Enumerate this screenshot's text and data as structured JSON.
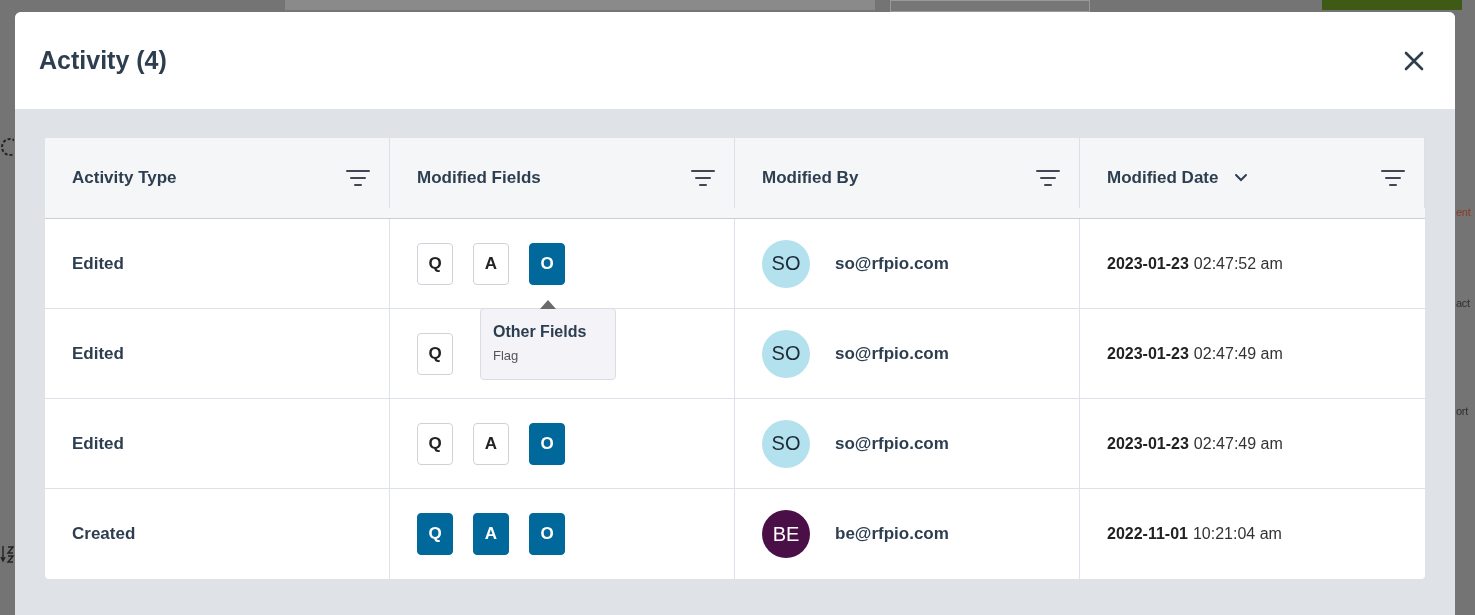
{
  "modal": {
    "title": "Activity (4)"
  },
  "table": {
    "columns": [
      {
        "label": "Activity Type",
        "sorted": false
      },
      {
        "label": "Modified Fields",
        "sorted": false
      },
      {
        "label": "Modified By",
        "sorted": false
      },
      {
        "label": "Modified Date",
        "sorted": true
      }
    ],
    "rows": [
      {
        "activity": "Edited",
        "fields": [
          {
            "label": "Q",
            "selected": false
          },
          {
            "label": "A",
            "selected": false
          },
          {
            "label": "O",
            "selected": true
          }
        ],
        "avatar": {
          "initials": "SO",
          "color": "#b3e1ed"
        },
        "email": "so@rfpio.com",
        "date": "2023-01-23",
        "time": "02:47:52 am"
      },
      {
        "activity": "Edited",
        "fields": [
          {
            "label": "Q",
            "selected": false
          }
        ],
        "avatar": {
          "initials": "SO",
          "color": "#b3e1ed"
        },
        "email": "so@rfpio.com",
        "date": "2023-01-23",
        "time": "02:47:49 am"
      },
      {
        "activity": "Edited",
        "fields": [
          {
            "label": "Q",
            "selected": false
          },
          {
            "label": "A",
            "selected": false
          },
          {
            "label": "O",
            "selected": true
          }
        ],
        "avatar": {
          "initials": "SO",
          "color": "#b3e1ed"
        },
        "email": "so@rfpio.com",
        "date": "2023-01-23",
        "time": "02:47:49 am"
      },
      {
        "activity": "Created",
        "fields": [
          {
            "label": "Q",
            "selected": true
          },
          {
            "label": "A",
            "selected": true
          },
          {
            "label": "O",
            "selected": true
          }
        ],
        "avatar": {
          "initials": "BE",
          "color": "#4b0f47"
        },
        "email": "be@rfpio.com",
        "date": "2022-11-01",
        "time": "10:21:04 am"
      }
    ]
  },
  "tooltip": {
    "title": "Other Fields",
    "text": "Flag"
  },
  "background_fragments": [
    {
      "text": "ent",
      "kind": "link"
    },
    {
      "text": "act",
      "kind": "plain"
    },
    {
      "text": "ort",
      "kind": "plain"
    }
  ]
}
